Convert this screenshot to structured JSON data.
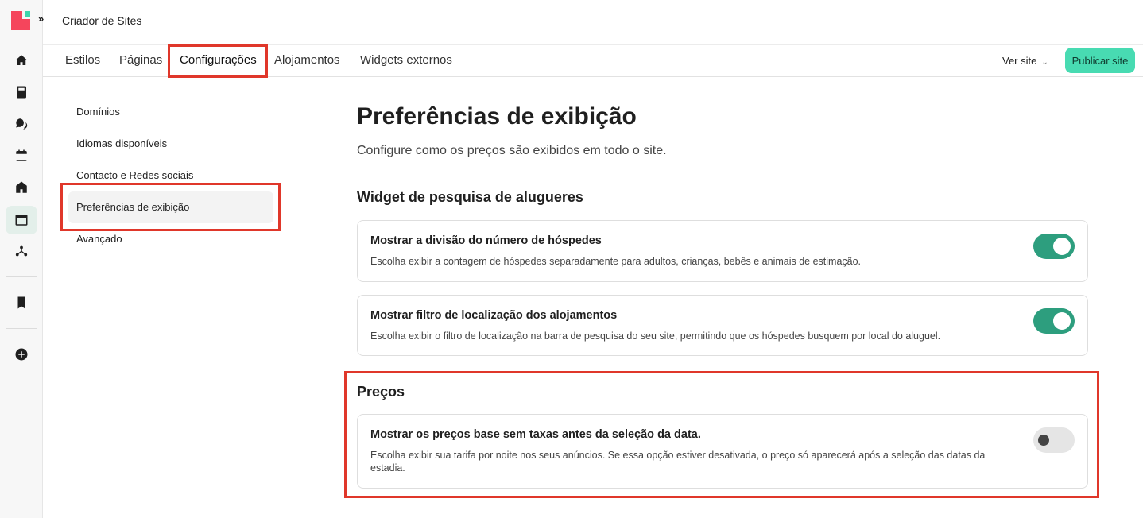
{
  "app": {
    "title": "Criador de Sites",
    "expand_glyph": "»"
  },
  "rail": {
    "icons": [
      "home-icon",
      "book-icon",
      "chat-bubbles-icon",
      "calendar-icon",
      "house-icon",
      "browser-window-icon",
      "network-icon",
      "bookmark-icon",
      "add-circle-icon"
    ],
    "active": "browser-window-icon"
  },
  "tabs": [
    {
      "label": "Estilos"
    },
    {
      "label": "Páginas"
    },
    {
      "label": "Configurações"
    },
    {
      "label": "Alojamentos"
    },
    {
      "label": "Widgets externos"
    }
  ],
  "active_tab": "Configurações",
  "header": {
    "view_site": "Ver site",
    "publish": "Publicar site"
  },
  "settings_nav": [
    {
      "label": "Domínios"
    },
    {
      "label": "Idiomas disponíveis"
    },
    {
      "label": "Contacto e Redes sociais"
    },
    {
      "label": "Preferências de exibição"
    },
    {
      "label": "Avançado"
    }
  ],
  "settings_nav_active": "Preferências de exibição",
  "page": {
    "title": "Preferências de exibição",
    "subtitle": "Configure como os preços são exibidos em todo o site."
  },
  "sections": [
    {
      "title": "Widget de pesquisa de alugueres",
      "options": [
        {
          "title": "Mostrar a divisão do número de hóspedes",
          "description": "Escolha exibir a contagem de hóspedes separadamente para adultos, crianças, bebês e animais de estimação.",
          "enabled": true
        },
        {
          "title": "Mostrar filtro de localização dos alojamentos",
          "description": "Escolha exibir o filtro de localização na barra de pesquisa do seu site, permitindo que os hóspedes busquem por local do aluguel.",
          "enabled": true
        }
      ]
    },
    {
      "title": "Preços",
      "options": [
        {
          "title": "Mostrar os preços base sem taxas antes da seleção da data.",
          "description": "Escolha exibir sua tarifa por noite nos seus anúncios. Se essa opção estiver desativada, o preço só aparecerá após a seleção das datas da estadia.",
          "enabled": false
        }
      ]
    }
  ],
  "colors": {
    "accent": "#48dbb2",
    "toggle_on": "#2d9e7e",
    "highlight": "#e0372a",
    "brand_red": "#f5455c"
  }
}
